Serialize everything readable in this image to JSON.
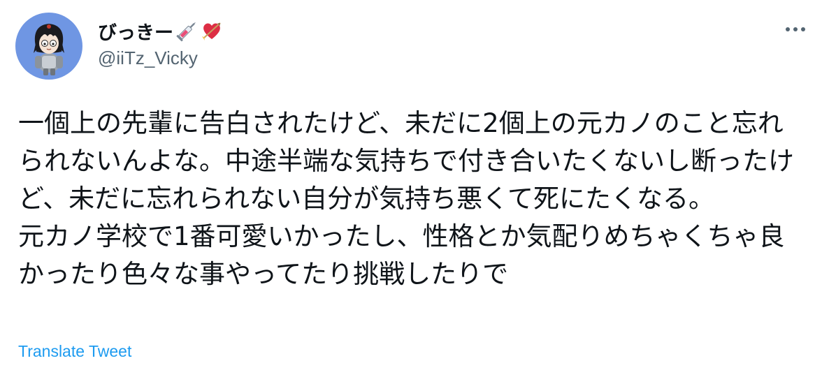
{
  "tweet": {
    "display_name": "びっきー",
    "name_emojis": [
      "syringe-emoji",
      "heart-with-arrow-emoji"
    ],
    "handle": "@iiTz_Vicky",
    "more_icon": "more-horizontal-icon",
    "text": "一個上の先輩に告白されたけど、未だに2個上の元カノのこと忘れられないんよな。中途半端な気持ちで付き合いたくないし断ったけど、未だに忘れられない自分が気持ち悪くて死にたくなる。\n元カノ学校で1番可愛いかったし、性格とか気配りめちゃくちゃ良かったり色々な事やってたり挑戦したりで",
    "translate_label": "Translate Tweet"
  },
  "colors": {
    "text_primary": "#0f1419",
    "text_secondary": "#536471",
    "link": "#1d9bf0",
    "avatar_bg": "#6f96e3"
  }
}
